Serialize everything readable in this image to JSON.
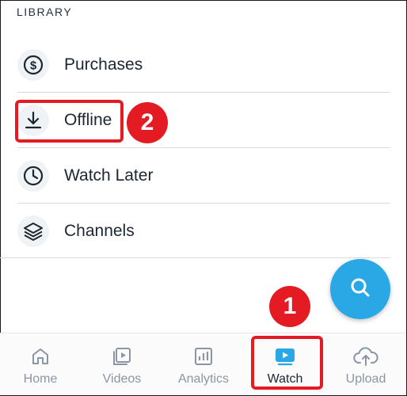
{
  "library": {
    "title": "LIBRARY",
    "items": [
      {
        "label": "Purchases",
        "icon": "dollar-circle-icon"
      },
      {
        "label": "Offline",
        "icon": "download-icon"
      },
      {
        "label": "Watch Later",
        "icon": "clock-icon"
      },
      {
        "label": "Channels",
        "icon": "layers-icon"
      }
    ]
  },
  "fab": {
    "icon": "search-icon",
    "color": "#2aa8e6"
  },
  "nav": {
    "items": [
      {
        "label": "Home",
        "icon": "home-icon"
      },
      {
        "label": "Videos",
        "icon": "videos-icon"
      },
      {
        "label": "Analytics",
        "icon": "analytics-icon"
      },
      {
        "label": "Watch",
        "icon": "watch-icon",
        "active": true
      },
      {
        "label": "Upload",
        "icon": "upload-icon"
      }
    ]
  },
  "annotations": {
    "badge_1": "1",
    "badge_2": "2",
    "highlight_color": "#e41b23"
  }
}
